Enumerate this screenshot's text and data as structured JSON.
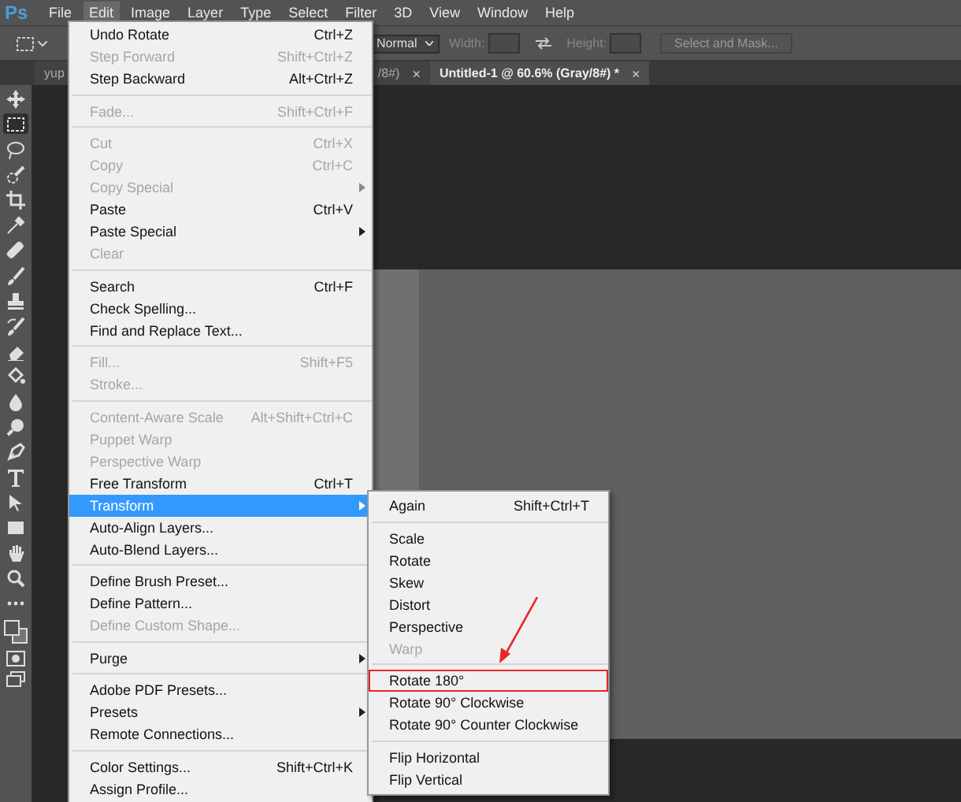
{
  "menubar": [
    {
      "label": "File",
      "selected": false
    },
    {
      "label": "Edit",
      "selected": true
    },
    {
      "label": "Image",
      "selected": false
    },
    {
      "label": "Layer",
      "selected": false
    },
    {
      "label": "Type",
      "selected": false
    },
    {
      "label": "Select",
      "selected": false
    },
    {
      "label": "Filter",
      "selected": false
    },
    {
      "label": "3D",
      "selected": false
    },
    {
      "label": "View",
      "selected": false
    },
    {
      "label": "Window",
      "selected": false
    },
    {
      "label": "Help",
      "selected": false
    }
  ],
  "logo": "Ps",
  "options_bar": {
    "blend_mode": "Normal",
    "width_label": "Width:",
    "height_label": "Height:",
    "mask_button": "Select and Mask..."
  },
  "document_tabs": [
    {
      "label_start": "yup",
      "label_end": "/8#)",
      "close": "×",
      "selected": false
    },
    {
      "label": "Untitled-1 @ 60.6% (Gray/8#) *",
      "close": "×",
      "selected": true
    }
  ],
  "tools": [
    {
      "selected": false
    },
    {
      "selected": true
    },
    {
      "selected": false
    },
    {
      "selected": false
    },
    {
      "selected": false
    },
    {
      "selected": false
    },
    {
      "selected": false
    },
    {
      "selected": false
    },
    {
      "selected": false
    },
    {
      "selected": false
    },
    {
      "selected": false
    },
    {
      "selected": false
    },
    {
      "selected": false
    },
    {
      "selected": false
    },
    {
      "selected": false
    },
    {
      "selected": false
    },
    {
      "selected": false
    },
    {
      "selected": false
    },
    {
      "selected": false
    },
    {
      "selected": false
    },
    {
      "selected": false
    }
  ],
  "edit_menu": {
    "items": [
      {
        "kind": "item",
        "label": "Undo Rotate",
        "shortcut": "Ctrl+Z",
        "disabled": false,
        "submenu": false,
        "selected": false
      },
      {
        "kind": "item",
        "label": "Step Forward",
        "shortcut": "Shift+Ctrl+Z",
        "disabled": true,
        "submenu": false,
        "selected": false
      },
      {
        "kind": "item",
        "label": "Step Backward",
        "shortcut": "Alt+Ctrl+Z",
        "disabled": false,
        "submenu": false,
        "selected": false
      },
      {
        "kind": "separator"
      },
      {
        "kind": "item",
        "label": "Fade...",
        "shortcut": "Shift+Ctrl+F",
        "disabled": true,
        "submenu": false,
        "selected": false
      },
      {
        "kind": "separator"
      },
      {
        "kind": "item",
        "label": "Cut",
        "shortcut": "Ctrl+X",
        "disabled": true,
        "submenu": false,
        "selected": false
      },
      {
        "kind": "item",
        "label": "Copy",
        "shortcut": "Ctrl+C",
        "disabled": true,
        "submenu": false,
        "selected": false
      },
      {
        "kind": "item",
        "label": "Copy Special",
        "disabled": true,
        "submenu": true,
        "selected": false
      },
      {
        "kind": "item",
        "label": "Paste",
        "shortcut": "Ctrl+V",
        "disabled": false,
        "submenu": false,
        "selected": false
      },
      {
        "kind": "item",
        "label": "Paste Special",
        "disabled": false,
        "submenu": true,
        "selected": false
      },
      {
        "kind": "item",
        "label": "Clear",
        "disabled": true,
        "submenu": false,
        "selected": false
      },
      {
        "kind": "separator"
      },
      {
        "kind": "item",
        "label": "Search",
        "shortcut": "Ctrl+F",
        "disabled": false,
        "submenu": false,
        "selected": false
      },
      {
        "kind": "item",
        "label": "Check Spelling...",
        "disabled": false,
        "submenu": false,
        "selected": false
      },
      {
        "kind": "item",
        "label": "Find and Replace Text...",
        "disabled": false,
        "submenu": false,
        "selected": false
      },
      {
        "kind": "separator"
      },
      {
        "kind": "item",
        "label": "Fill...",
        "shortcut": "Shift+F5",
        "disabled": true,
        "submenu": false,
        "selected": false
      },
      {
        "kind": "item",
        "label": "Stroke...",
        "disabled": true,
        "submenu": false,
        "selected": false
      },
      {
        "kind": "separator"
      },
      {
        "kind": "item",
        "label": "Content-Aware Scale",
        "shortcut": "Alt+Shift+Ctrl+C",
        "disabled": true,
        "submenu": false,
        "selected": false
      },
      {
        "kind": "item",
        "label": "Puppet Warp",
        "disabled": true,
        "submenu": false,
        "selected": false
      },
      {
        "kind": "item",
        "label": "Perspective Warp",
        "disabled": true,
        "submenu": false,
        "selected": false
      },
      {
        "kind": "item",
        "label": "Free Transform",
        "shortcut": "Ctrl+T",
        "disabled": false,
        "submenu": false,
        "selected": false
      },
      {
        "kind": "item",
        "label": "Transform",
        "disabled": false,
        "submenu": true,
        "selected": true
      },
      {
        "kind": "item",
        "label": "Auto-Align Layers...",
        "disabled": false,
        "submenu": false,
        "selected": false
      },
      {
        "kind": "item",
        "label": "Auto-Blend Layers...",
        "disabled": false,
        "submenu": false,
        "selected": false
      },
      {
        "kind": "separator"
      },
      {
        "kind": "item",
        "label": "Define Brush Preset...",
        "disabled": false,
        "submenu": false,
        "selected": false
      },
      {
        "kind": "item",
        "label": "Define Pattern...",
        "disabled": false,
        "submenu": false,
        "selected": false
      },
      {
        "kind": "item",
        "label": "Define Custom Shape...",
        "disabled": true,
        "submenu": false,
        "selected": false
      },
      {
        "kind": "separator"
      },
      {
        "kind": "item",
        "label": "Purge",
        "disabled": false,
        "submenu": true,
        "selected": false
      },
      {
        "kind": "separator"
      },
      {
        "kind": "item",
        "label": "Adobe PDF Presets...",
        "disabled": false,
        "submenu": false,
        "selected": false
      },
      {
        "kind": "item",
        "label": "Presets",
        "disabled": false,
        "submenu": true,
        "selected": false
      },
      {
        "kind": "item",
        "label": "Remote Connections...",
        "disabled": false,
        "submenu": false,
        "selected": false
      },
      {
        "kind": "separator"
      },
      {
        "kind": "item",
        "label": "Color Settings...",
        "shortcut": "Shift+Ctrl+K",
        "disabled": false,
        "submenu": false,
        "selected": false
      },
      {
        "kind": "item",
        "label": "Assign Profile...",
        "disabled": false,
        "submenu": false,
        "selected": false
      }
    ]
  },
  "transform_submenu": {
    "items": [
      {
        "kind": "item",
        "label": "Again",
        "shortcut": "Shift+Ctrl+T",
        "disabled": false,
        "annotated": false
      },
      {
        "kind": "separator"
      },
      {
        "kind": "item",
        "label": "Scale",
        "disabled": false,
        "annotated": false
      },
      {
        "kind": "item",
        "label": "Rotate",
        "disabled": false,
        "annotated": false
      },
      {
        "kind": "item",
        "label": "Skew",
        "disabled": false,
        "annotated": false
      },
      {
        "kind": "item",
        "label": "Distort",
        "disabled": false,
        "annotated": false
      },
      {
        "kind": "item",
        "label": "Perspective",
        "disabled": false,
        "annotated": false
      },
      {
        "kind": "item",
        "label": "Warp",
        "disabled": true,
        "annotated": false
      },
      {
        "kind": "separator"
      },
      {
        "kind": "item",
        "label": "Rotate 180°",
        "disabled": false,
        "annotated": true
      },
      {
        "kind": "item",
        "label": "Rotate 90° Clockwise",
        "disabled": false,
        "annotated": false
      },
      {
        "kind": "item",
        "label": "Rotate 90° Counter Clockwise",
        "disabled": false,
        "annotated": false
      },
      {
        "kind": "separator"
      },
      {
        "kind": "item",
        "label": "Flip Horizontal",
        "disabled": false,
        "annotated": false
      },
      {
        "kind": "item",
        "label": "Flip Vertical",
        "disabled": false,
        "annotated": false
      }
    ]
  }
}
